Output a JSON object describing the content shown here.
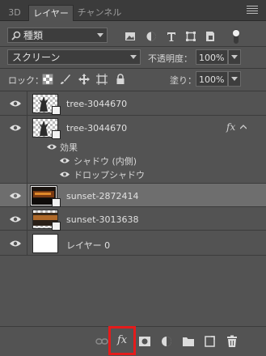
{
  "tabs": [
    {
      "label": "3D"
    },
    {
      "label": "レイヤー"
    },
    {
      "label": "チャンネル"
    }
  ],
  "filter": {
    "kind_label": "種類",
    "icons": [
      "image-filter-icon",
      "adjustment-filter-icon",
      "type-filter-icon",
      "shape-filter-icon",
      "smart-object-filter-icon",
      "filter-toggle-icon"
    ]
  },
  "blend": {
    "mode": "スクリーン",
    "opacity_label": "不透明度：",
    "opacity_value": "100%"
  },
  "lock": {
    "label": "ロック：",
    "fill_label": "塗り：",
    "fill_value": "100%"
  },
  "layers": [
    {
      "name": "tree-3044670",
      "thumb": "tree",
      "smart": true,
      "fx": false,
      "selected": false
    },
    {
      "name": "tree-3044670",
      "thumb": "tree",
      "smart": true,
      "fx": true,
      "fx_label": "fx",
      "selected": false,
      "effects_label": "効果",
      "effects": [
        "シャドウ (内側)",
        "ドロップシャドウ"
      ]
    },
    {
      "name": "sunset-2872414",
      "thumb": "sunset",
      "smart": true,
      "selected": true
    },
    {
      "name": "sunset-3013638",
      "thumb": "sunset2",
      "smart": true,
      "selected": false
    },
    {
      "name": "レイヤー 0",
      "thumb": "white",
      "smart": false,
      "selected": false
    }
  ],
  "bottom_buttons": [
    {
      "name": "link-layers-icon"
    },
    {
      "name": "fx-icon",
      "label": "fx"
    },
    {
      "name": "add-mask-icon"
    },
    {
      "name": "adjustment-layer-icon"
    },
    {
      "name": "new-group-icon"
    },
    {
      "name": "new-layer-icon"
    },
    {
      "name": "delete-layer-icon"
    }
  ],
  "highlight_color": "#e41b1b"
}
